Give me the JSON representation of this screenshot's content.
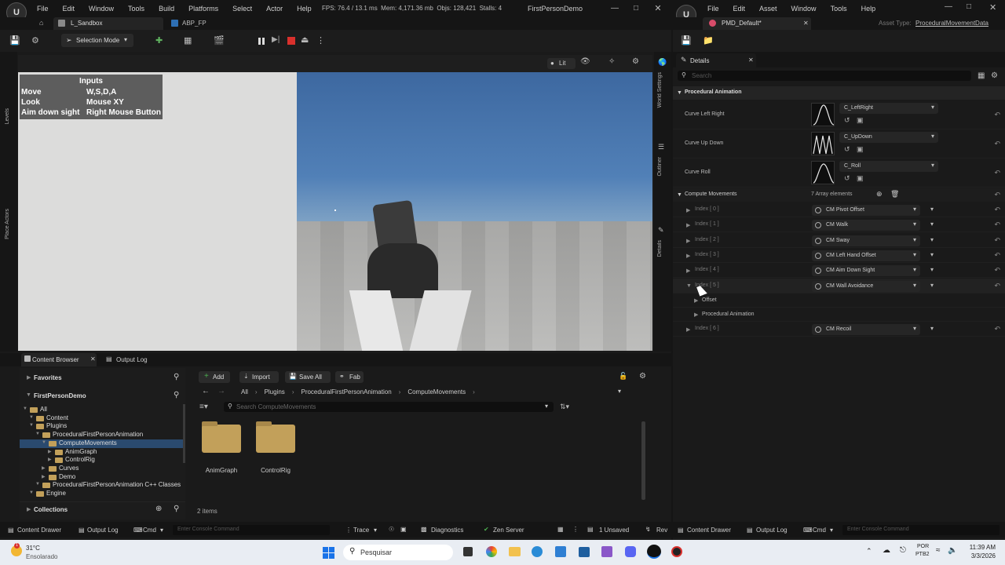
{
  "main_window": {
    "menu": [
      "File",
      "Edit",
      "Window",
      "Tools",
      "Build",
      "Platforms",
      "Select",
      "Actor",
      "Help"
    ],
    "stats": {
      "fps": "FPS: 76.4",
      "ms": "/ 13.1 ms",
      "mem": "Mem: 4,171.36 mb",
      "objs": "Objs: 128,421",
      "stalls": "Stalls: 4"
    },
    "title": "FirstPersonDemo",
    "tabs": [
      {
        "label": "L_Sandbox"
      },
      {
        "label": "ABP_FP"
      }
    ],
    "selection_mode": "Selection Mode",
    "viewport": {
      "lit_label": "Lit",
      "inputs_title": "Inputs",
      "inputs": [
        {
          "action": "Move",
          "key": "W,S,D,A"
        },
        {
          "action": "Look",
          "key": "Mouse XY"
        },
        {
          "action": "Aim down sight",
          "key": "Right Mouse Button"
        }
      ]
    },
    "side_tabs": [
      "Levels",
      "Place Actors"
    ],
    "right_side_tabs": [
      "World Settings",
      "Outliner",
      "Details"
    ],
    "bottom_tabs": {
      "content_browser": "Content Browser",
      "output_log": "Output Log"
    },
    "content_browser": {
      "favorites": "Favorites",
      "project": "FirstPersonDemo",
      "collections": "Collections",
      "toolbar": {
        "add": "Add",
        "import": "Import",
        "save_all": "Save All",
        "fab": "Fab"
      },
      "breadcrumb": [
        "All",
        "Plugins",
        "ProceduralFirstPersonAnimation",
        "ComputeMovements"
      ],
      "search_placeholder": "Search ComputeMovements",
      "tree": [
        {
          "label": "All",
          "indent": 0
        },
        {
          "label": "Content",
          "indent": 1
        },
        {
          "label": "Plugins",
          "indent": 1
        },
        {
          "label": "ProceduralFirstPersonAnimation",
          "indent": 2
        },
        {
          "label": "ComputeMovements",
          "indent": 3,
          "selected": true
        },
        {
          "label": "AnimGraph",
          "indent": 4
        },
        {
          "label": "ControlRig",
          "indent": 4
        },
        {
          "label": "Curves",
          "indent": 3
        },
        {
          "label": "Demo",
          "indent": 3
        },
        {
          "label": "ProceduralFirstPersonAnimation C++ Classes",
          "indent": 2
        },
        {
          "label": "Engine",
          "indent": 1
        }
      ],
      "items": [
        {
          "label": "AnimGraph"
        },
        {
          "label": "ControlRig"
        }
      ],
      "count": "2 items"
    },
    "status_bar": {
      "content_drawer": "Content Drawer",
      "output_log": "Output Log",
      "cmd": "Cmd",
      "console_placeholder": "Enter Console Command",
      "trace": "Trace",
      "diagnostics": "Diagnostics",
      "zen_server": "Zen Server",
      "unsaved": "1 Unsaved",
      "rev": "Rev"
    }
  },
  "asset_window": {
    "menu": [
      "File",
      "Edit",
      "Asset",
      "Window",
      "Tools",
      "Help"
    ],
    "tab": "PMD_Default*",
    "asset_type_label": "Asset Type:",
    "asset_type_value": "ProceduralMovementData",
    "details_tab": "Details",
    "search_placeholder": "Search",
    "section": "Procedural Animation",
    "curves": [
      {
        "label": "Curve Left Right",
        "value": "C_LeftRight"
      },
      {
        "label": "Curve Up Down",
        "value": "C_UpDown"
      },
      {
        "label": "Curve Roll",
        "value": "C_Roll"
      }
    ],
    "compute_movements": {
      "label": "Compute Movements",
      "count": "7 Array elements"
    },
    "elements": [
      {
        "index": "Index [ 0 ]",
        "value": "CM Pivot Offset"
      },
      {
        "index": "Index [ 1 ]",
        "value": "CM Walk"
      },
      {
        "index": "Index [ 2 ]",
        "value": "CM Sway"
      },
      {
        "index": "Index [ 3 ]",
        "value": "CM Left Hand Offset"
      },
      {
        "index": "Index [ 4 ]",
        "value": "CM Aim Down Sight"
      },
      {
        "index": "Index [ 5 ]",
        "value": "CM Wall Avoidance",
        "expanded": true,
        "children": [
          "Offset",
          "Procedural Animation"
        ]
      },
      {
        "index": "Index [ 6 ]",
        "value": "CM Recoil"
      }
    ],
    "status_bar": {
      "content_drawer": "Content Drawer",
      "output_log": "Output Log",
      "cmd": "Cmd",
      "console_placeholder": "Enter Console Command"
    }
  },
  "taskbar": {
    "temperature": "31°C",
    "weather": "Ensolarado",
    "search": "Pesquisar",
    "lang1": "POR",
    "lang2": "PTB2",
    "time": "11:39 AM",
    "date": "3/3/2026",
    "notification_badge": "1"
  },
  "colors": {
    "accent": "#0070e0",
    "selected": "#2a4a6e",
    "folder": "#c2a05a",
    "red": "#d9302c",
    "green": "#4caf50"
  }
}
